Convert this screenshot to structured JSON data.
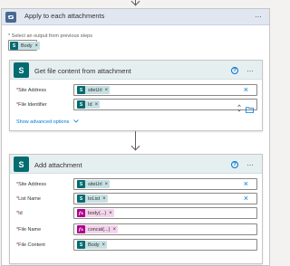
{
  "loop": {
    "title": "Apply to each attachments",
    "more_label": "···",
    "select_label": "* Select an output from previous steps",
    "select_token": {
      "label": "Body",
      "icon": "sharepoint-icon"
    }
  },
  "get_file": {
    "title": "Get file content from attachment",
    "more_label": "···",
    "help_label": "?",
    "fields": [
      {
        "label": "Site Address",
        "token": "siteUrl",
        "token_type": "sharepoint"
      },
      {
        "label": "File Identifier",
        "token": "Id",
        "token_type": "sharepoint"
      }
    ],
    "show_advanced": "Show advanced options"
  },
  "add_attachment": {
    "title": "Add attachment",
    "more_label": "···",
    "help_label": "?",
    "fields": [
      {
        "label": "Site Address",
        "token": "siteUrl",
        "token_type": "sharepoint"
      },
      {
        "label": "List Name",
        "token": "toList",
        "token_type": "sharepoint"
      },
      {
        "label": "Id",
        "token": "body(...)",
        "token_type": "expression"
      },
      {
        "label": "File Name",
        "token": "concat(...)",
        "token_type": "expression"
      },
      {
        "label": "File Content",
        "token": "Body",
        "token_type": "sharepoint"
      }
    ]
  },
  "colors": {
    "sharepoint": "#036c70",
    "expression": "#ad008c",
    "loop": "#486991",
    "link": "#0078d4"
  }
}
